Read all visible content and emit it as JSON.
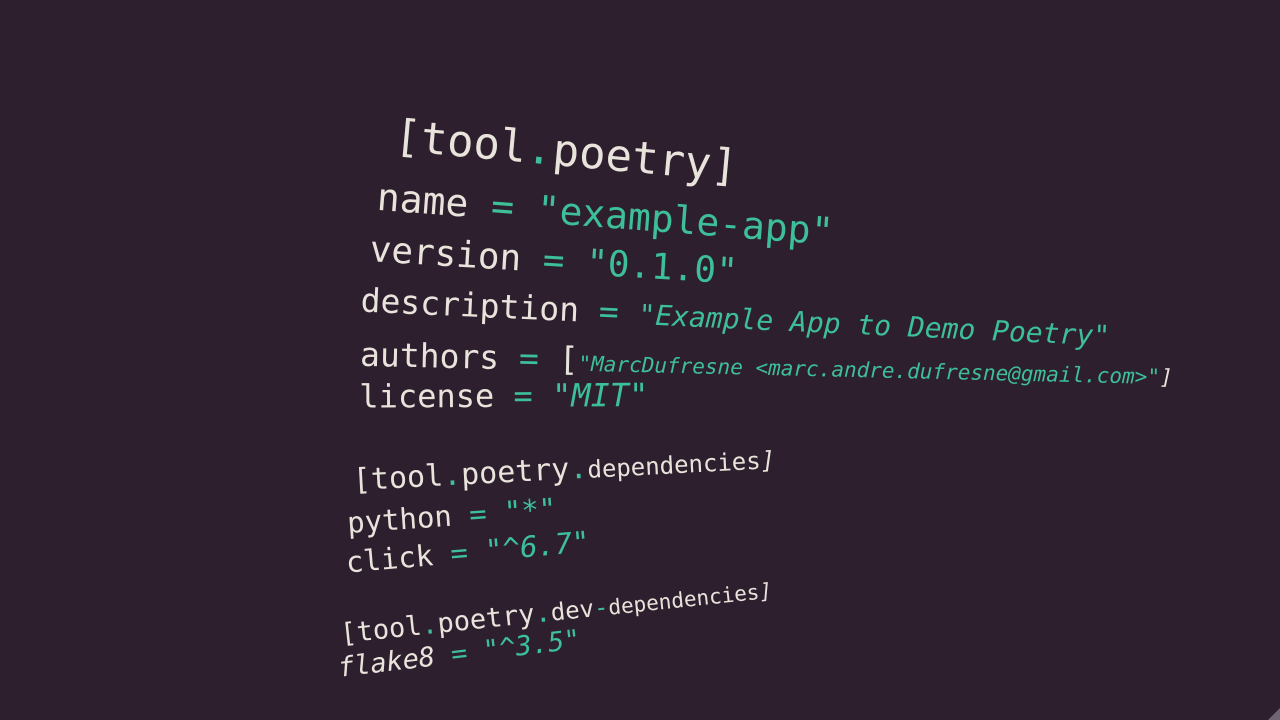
{
  "colors": {
    "background": "#2e1f2e",
    "text": "#e8e4dc",
    "accent": "#3dbf9a"
  },
  "code": {
    "poetry": {
      "header_open": "[tool",
      "header_dot": ".",
      "header_name": "poetry",
      "header_close": "]",
      "name_key": "name",
      "name_value": "\"example-app\"",
      "version_key": "version",
      "version_value": "\"0.1.0\"",
      "description_key": "description",
      "description_value": "\"Example App to Demo Poetry\"",
      "authors_key": "authors",
      "authors_open": "[",
      "authors_value": "\"MarcDufresne <marc.andre.dufresne@gmail.com>\"",
      "authors_close": "]",
      "license_key": "license",
      "license_value": "\"MIT\""
    },
    "dependencies": {
      "header_open": "[tool",
      "dot1": ".",
      "poetry": "poetry",
      "dot2": ".",
      "section": "dependencies",
      "header_close": "]",
      "python_key": "python",
      "python_value": "\"*\"",
      "click_key": "click",
      "click_value": "\"^6.7\""
    },
    "dev_dependencies": {
      "header_open": "[tool",
      "dot1": ".",
      "poetry": "poetry",
      "dot2": ".",
      "section_a": "dev",
      "dash": "-",
      "section_b": "dependencies",
      "header_close": "]",
      "flake8_key": "flake8",
      "flake8_value": "\"^3.5\""
    },
    "equals": "="
  }
}
